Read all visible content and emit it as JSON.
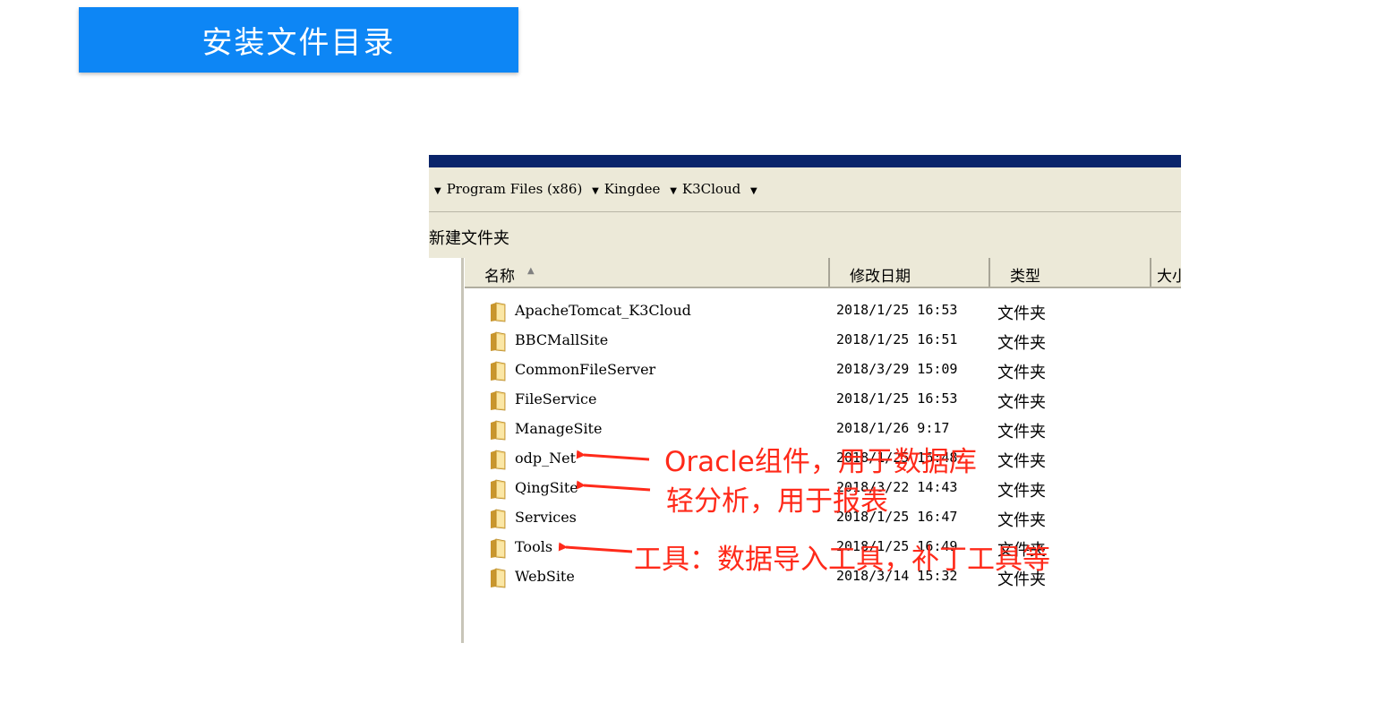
{
  "slide": {
    "title": "安装文件目录"
  },
  "explorer": {
    "breadcrumb": [
      {
        "label": "Program Files (x86)"
      },
      {
        "label": "Kingdee"
      },
      {
        "label": "K3Cloud"
      }
    ],
    "toolbar": {
      "new_folder_label": "新建文件夹"
    },
    "columns": {
      "name": "名称",
      "date": "修改日期",
      "type": "类型",
      "size": "大小"
    },
    "files": [
      {
        "name": "ApacheTomcat_K3Cloud",
        "modified": "2018/1/25 16:53",
        "type": "文件夹"
      },
      {
        "name": "BBCMallSite",
        "modified": "2018/1/25 16:51",
        "type": "文件夹"
      },
      {
        "name": "CommonFileServer",
        "modified": "2018/3/29 15:09",
        "type": "文件夹"
      },
      {
        "name": "FileService",
        "modified": "2018/1/25 16:53",
        "type": "文件夹"
      },
      {
        "name": "ManageSite",
        "modified": "2018/1/26 9:17",
        "type": "文件夹"
      },
      {
        "name": "odp_Net",
        "modified": "2018/1/25 16:48",
        "type": "文件夹"
      },
      {
        "name": "QingSite",
        "modified": "2018/3/22 14:43",
        "type": "文件夹"
      },
      {
        "name": "Services",
        "modified": "2018/1/25 16:47",
        "type": "文件夹"
      },
      {
        "name": "Tools",
        "modified": "2018/1/25 16:49",
        "type": "文件夹"
      },
      {
        "name": "WebSite",
        "modified": "2018/3/14 15:32",
        "type": "文件夹"
      }
    ]
  },
  "annotations": {
    "oracle": "Oracle组件，用于数据库",
    "qing": "轻分析，用于报表",
    "tools": "工具：数据导入工具，补丁工具等",
    "color": "#ff2a1a"
  },
  "colors": {
    "banner": "#0d86f5",
    "titlebar": "#0a246a",
    "chrome": "#ece9d8"
  }
}
